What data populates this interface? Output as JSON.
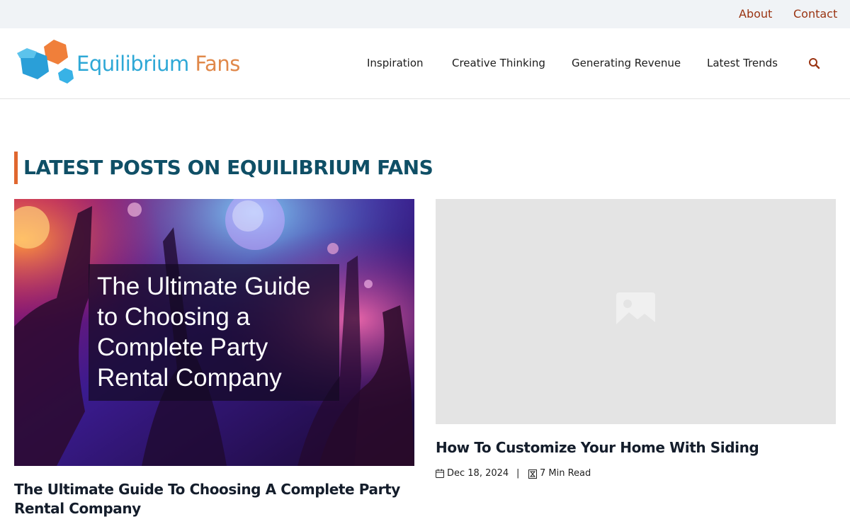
{
  "topbar": {
    "links": [
      "About",
      "Contact"
    ]
  },
  "header": {
    "logo": {
      "word1": "Equilibrium",
      "word2": "Fans"
    },
    "nav": [
      "Inspiration",
      "Creative Thinking",
      "Generating Revenue",
      "Latest Trends"
    ],
    "search_icon": "search-icon"
  },
  "section": {
    "title": "LATEST POSTS ON EQUILIBRIUM FANS"
  },
  "posts": [
    {
      "image_caption": "The Ultimate Guide to Choosing a Complete Party Rental Company",
      "title": "The Ultimate Guide To Choosing A Complete Party Rental Company"
    },
    {
      "image_icon": "image-placeholder-icon",
      "title": "How To Customize Your Home With Siding",
      "date": "Dec 18, 2024",
      "separator": "|",
      "read_time": "7 Min Read"
    }
  ],
  "colors": {
    "accent": "#e0672f",
    "heading": "#0f4f66",
    "link": "#9a3412",
    "logo_blue": "#2ea8d6",
    "logo_orange": "#e0884a"
  }
}
